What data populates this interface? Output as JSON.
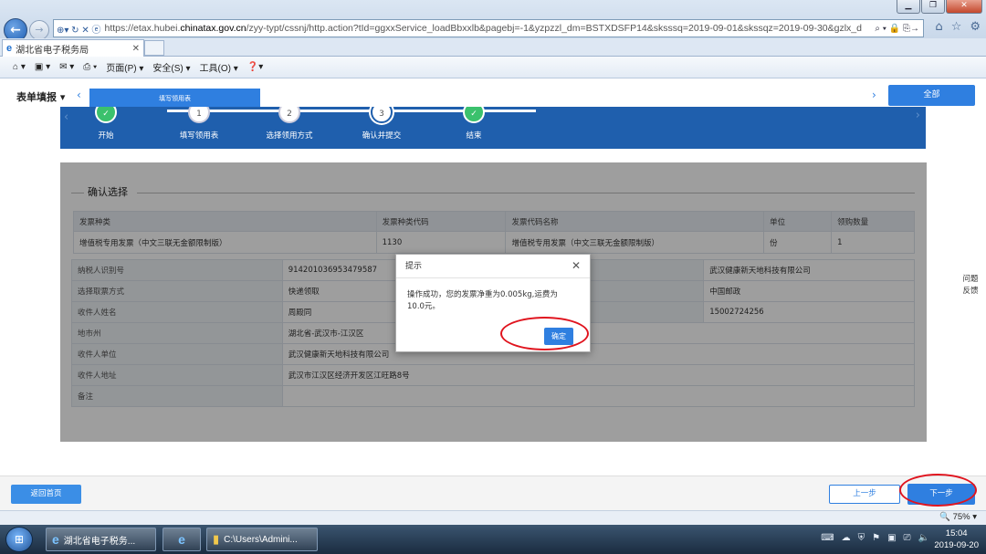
{
  "browser": {
    "url_prefix": "https://etax.hubei.",
    "url_host": "chinatax.gov.cn",
    "url_rest": "/zyy-typt/cssnj/http.action?tId=ggxxService_loadBbxxlb&pagebj=-1&yzpzzl_dm=BSTXDSFP14&sksssq=2019-09-01&skssqz=2019-09-30&gzlx_d",
    "tab_title": "湖北省电子税务局",
    "cmd_page": "页面(P) ▾",
    "cmd_safety": "安全(S) ▾",
    "cmd_tools": "工具(O) ▾",
    "zoom": "75%"
  },
  "page": {
    "form_fill": "表单填报",
    "active_tab": "填写领用表",
    "all_button": "全部",
    "steps": [
      "开始",
      "填写领用表",
      "选择领用方式",
      "确认并提交",
      "结束"
    ],
    "step_numbers": [
      "1",
      "2",
      "3"
    ]
  },
  "confirm": {
    "title": "确认选择",
    "headers": [
      "发票种类",
      "发票种类代码",
      "发票代码名称",
      "单位",
      "领购数量"
    ],
    "row": [
      "增值税专用发票（中文三联无金额限制版）",
      "1130",
      "增值税专用发票（中文三联无金额限制版）",
      "份",
      "1"
    ],
    "details": [
      {
        "label": "纳税人识别号",
        "value": "914201036953479587",
        "value2": "武汉健康新天地科技有限公司"
      },
      {
        "label": "选择取票方式",
        "value": "快递领取",
        "value2": "中国邮政"
      },
      {
        "label": "收件人姓名",
        "value": "周殿同",
        "value2": "15002724256"
      },
      {
        "label": "地市州",
        "value": "湖北省-武汉市-江汉区"
      },
      {
        "label": "收件人单位",
        "value": "武汉健康新天地科技有限公司"
      },
      {
        "label": "收件人地址",
        "value": "武汉市江汉区经济开发区江旺路8号"
      },
      {
        "label": "备注",
        "value": ""
      }
    ]
  },
  "dialog": {
    "title": "提示",
    "message": "操作成功，您的发票净重为0.005kg,运费为10.0元。",
    "ok": "确定"
  },
  "side": {
    "feedback": "问题反馈"
  },
  "footer": {
    "back_home": "返回首页",
    "prev": "上一步",
    "next": "下一步"
  },
  "taskbar": {
    "ie_task": "湖北省电子税务...",
    "folder_task": "C:\\Users\\Admini...",
    "time": "15:04",
    "date": "2019-09-20"
  }
}
